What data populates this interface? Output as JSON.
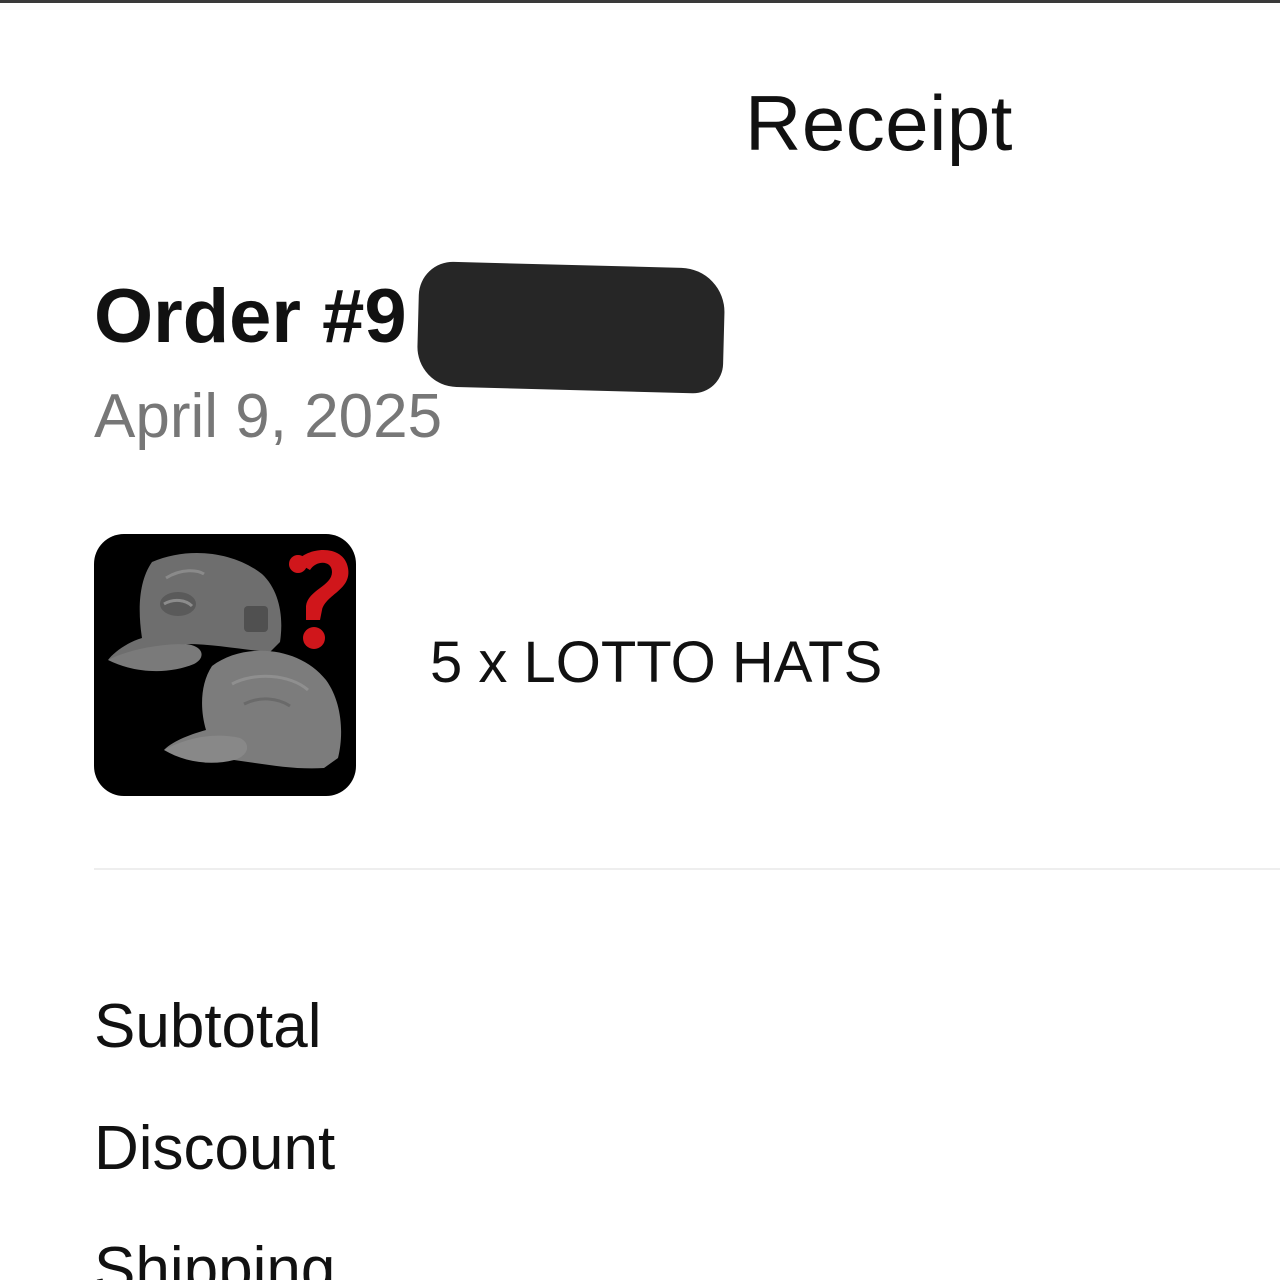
{
  "header": {
    "title": "Receipt"
  },
  "order": {
    "number_label": "Order #9",
    "number_redacted": true,
    "date": "April 9, 2025"
  },
  "items": [
    {
      "name": "5 x LOTTO HATS",
      "image": "lotto-hats-thumbnail"
    }
  ],
  "summary": {
    "subtotal_label": "Subtotal",
    "discount_label": "Discount",
    "shipping_label": "Shipping"
  },
  "colors": {
    "text": "#111111",
    "muted_text": "#777777",
    "divider": "#eeeeee",
    "redaction": "#262626",
    "thumb_bg": "#000000",
    "question_mark": "#d0161b"
  }
}
